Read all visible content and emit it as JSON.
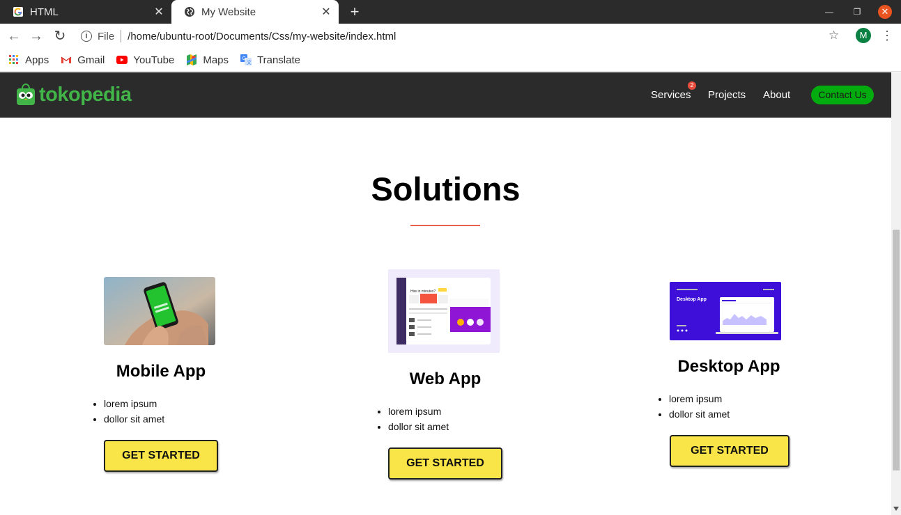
{
  "browser": {
    "tabs": [
      {
        "title": "HTML",
        "favicon": "google-g-icon"
      },
      {
        "title": "My Website",
        "favicon": "globe-icon"
      }
    ],
    "address": {
      "scheme_label": "File",
      "url": "/home/ubuntu-root/Documents/Css/my-website/index.html"
    },
    "profile_initial": "M",
    "bookmarks": [
      {
        "label": "Apps",
        "icon": "apps-grid-icon"
      },
      {
        "label": "Gmail",
        "icon": "gmail-icon"
      },
      {
        "label": "YouTube",
        "icon": "youtube-icon"
      },
      {
        "label": "Maps",
        "icon": "maps-icon"
      },
      {
        "label": "Translate",
        "icon": "translate-icon"
      }
    ]
  },
  "site": {
    "brand": "tokopedia",
    "nav": {
      "services": "Services",
      "services_badge": "2",
      "projects": "Projects",
      "about": "About",
      "contact": "Contact Us"
    },
    "section_title": "Solutions",
    "cards": [
      {
        "title": "Mobile App",
        "bullets": [
          "lorem ipsum",
          "dollor sit amet"
        ],
        "button": "GET STARTED"
      },
      {
        "title": "Web App",
        "bullets": [
          "lorem ipsum",
          "dollor sit amet"
        ],
        "button": "GET STARTED"
      },
      {
        "title": "Desktop App",
        "bullets": [
          "lorem ipsum",
          "dollor sit amet"
        ],
        "button": "GET STARTED"
      }
    ],
    "thumbnail_texts": {
      "web_heading": "Hire in minutes?",
      "desktop_heading": "Desktop App"
    }
  },
  "colors": {
    "navbar": "#2b2b2b",
    "brand_green": "#42b549",
    "contact_button": "#03ac0e",
    "accent_underline": "#e9614a",
    "cta_yellow": "#f9e547"
  }
}
